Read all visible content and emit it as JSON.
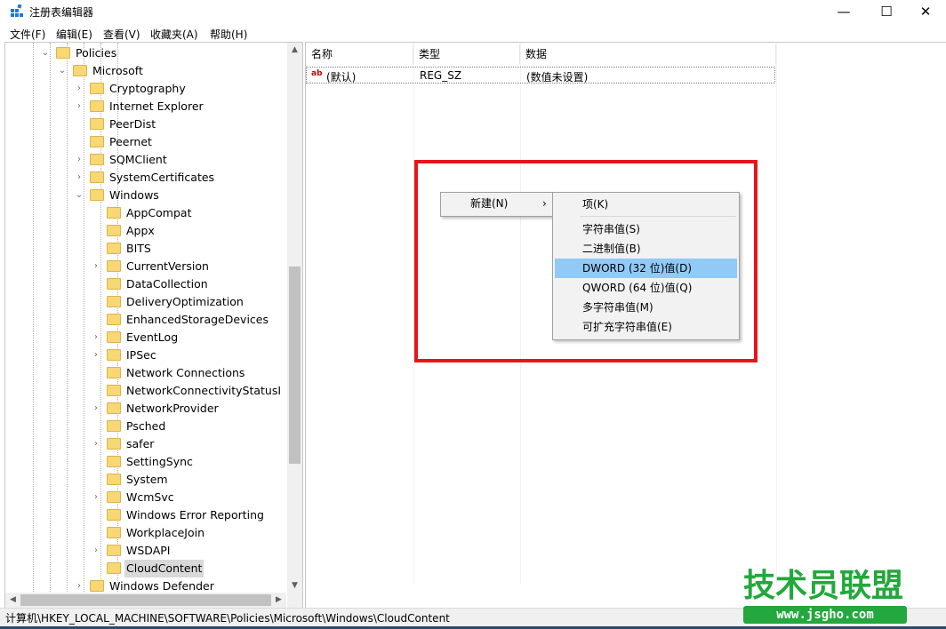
{
  "window": {
    "title": "注册表编辑器",
    "minimize_symbol": "—",
    "maximize_symbol": "☐",
    "close_symbol": "✕"
  },
  "menubar": [
    "文件(F)",
    "编辑(E)",
    "查看(V)",
    "收藏夹(A)",
    "帮助(H)"
  ],
  "tree": {
    "items": [
      {
        "label": "Policies",
        "expander": "⌄"
      },
      {
        "label": "Microsoft",
        "expander": "⌄"
      },
      {
        "label": "Cryptography",
        "expander": "›"
      },
      {
        "label": "Internet Explorer",
        "expander": "›"
      },
      {
        "label": "PeerDist",
        "expander": ""
      },
      {
        "label": "Peernet",
        "expander": ""
      },
      {
        "label": "SQMClient",
        "expander": "›"
      },
      {
        "label": "SystemCertificates",
        "expander": "›"
      },
      {
        "label": "Windows",
        "expander": "⌄"
      },
      {
        "label": "AppCompat",
        "expander": ""
      },
      {
        "label": "Appx",
        "expander": ""
      },
      {
        "label": "BITS",
        "expander": ""
      },
      {
        "label": "CurrentVersion",
        "expander": "›"
      },
      {
        "label": "DataCollection",
        "expander": ""
      },
      {
        "label": "DeliveryOptimization",
        "expander": ""
      },
      {
        "label": "EnhancedStorageDevices",
        "expander": ""
      },
      {
        "label": "EventLog",
        "expander": "›"
      },
      {
        "label": "IPSec",
        "expander": "›"
      },
      {
        "label": "Network Connections",
        "expander": ""
      },
      {
        "label": "NetworkConnectivityStatusI",
        "expander": ""
      },
      {
        "label": "NetworkProvider",
        "expander": "›"
      },
      {
        "label": "Psched",
        "expander": ""
      },
      {
        "label": "safer",
        "expander": "›"
      },
      {
        "label": "SettingSync",
        "expander": ""
      },
      {
        "label": "System",
        "expander": ""
      },
      {
        "label": "WcmSvc",
        "expander": "›"
      },
      {
        "label": "Windows Error Reporting",
        "expander": ""
      },
      {
        "label": "WorkplaceJoin",
        "expander": ""
      },
      {
        "label": "WSDAPI",
        "expander": "›"
      },
      {
        "label": "CloudContent",
        "expander": ""
      },
      {
        "label": "Windows Defender",
        "expander": "›"
      }
    ],
    "selected": "CloudContent",
    "scroll_up": "▲",
    "scroll_down": "▼",
    "scroll_left": "◀",
    "scroll_right": "▶"
  },
  "list": {
    "columns": [
      "名称",
      "类型",
      "数据"
    ],
    "rows": [
      {
        "icon": "ab",
        "name": "(默认)",
        "type": "REG_SZ",
        "data": "(数值未设置)"
      }
    ]
  },
  "context_menu": {
    "new_label": "新建(N)",
    "arrow": "›"
  },
  "submenu": {
    "items": [
      "项(K)",
      "字符串值(S)",
      "二进制值(B)",
      "DWORD (32 位)值(D)",
      "QWORD (64 位)值(Q)",
      "多字符串值(M)",
      "可扩充字符串值(E)"
    ],
    "highlighted": "DWORD (32 位)值(D)"
  },
  "statusbar": {
    "path": "计算机\\HKEY_LOCAL_MACHINE\\SOFTWARE\\Policies\\Microsoft\\Windows\\CloudContent"
  },
  "watermark": {
    "title": "技术员联盟",
    "url": "www.jsgho.com"
  },
  "colors": {
    "highlight_box": "#e8141b",
    "menu_highlight": "#91c9f7",
    "folder": "#f8d775",
    "watermark": "#22a83c"
  }
}
